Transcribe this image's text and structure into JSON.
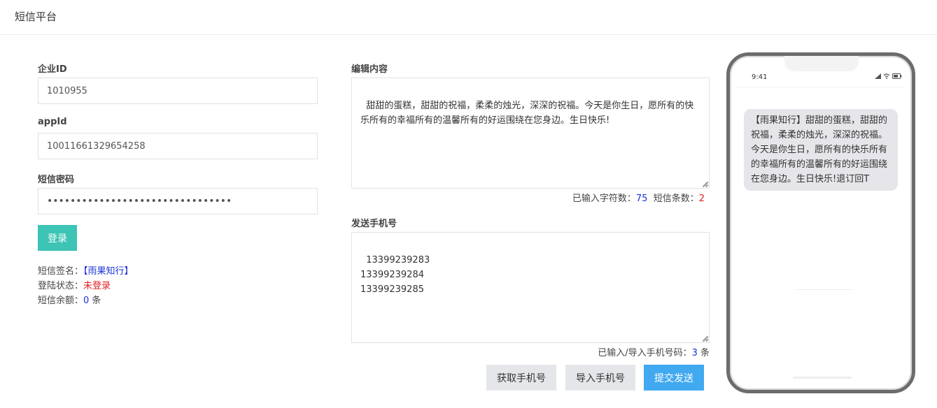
{
  "header": {
    "title": "短信平台"
  },
  "login": {
    "company_id_label": "企业ID",
    "company_id_value": "1010955",
    "app_id_label": "appId",
    "app_id_value": "10011661329654258",
    "sms_key_label": "短信密码",
    "sms_key_value": "••••••••••••••••••••••••••••••••",
    "login_button": "登录"
  },
  "status": {
    "signature_label": "短信签名：",
    "signature_value": "【雨果知行】",
    "login_state_label": "登陆状态：",
    "login_state_value": "未登录",
    "balance_label": "短信余额：",
    "balance_value": "0",
    "balance_unit": " 条"
  },
  "editor": {
    "content_label": "编辑内容",
    "content_value": "甜甜的蛋糕，甜甜的祝福，柔柔的烛光，深深的祝福。今天是你生日，愿所有的快乐所有的幸福所有的温馨所有的好运围绕在您身边。生日快乐!",
    "char_count_label": "已输入字符数：",
    "char_count_value": "75",
    "sms_count_label": "短信条数：",
    "sms_count_value": "2"
  },
  "phones": {
    "label": "发送手机号",
    "value": "13399239283\n13399239284\n13399239285",
    "count_label": "已输入/导入手机号码：",
    "count_value": "3",
    "count_unit": " 条"
  },
  "actions": {
    "get_phones": "获取手机号",
    "import_phones": "导入手机号",
    "submit_send": "提交发送"
  },
  "preview": {
    "time": "9:41",
    "message": "【雨果知行】甜甜的蛋糕，甜甜的祝福，柔柔的烛光，深深的祝福。今天是你生日，愿所有的快乐所有的幸福所有的温馨所有的好运围绕在您身边。生日快乐!退订回T"
  },
  "colors": {
    "primary_green": "#3dc4b5",
    "primary_blue": "#41a9f0",
    "link_blue": "#1a33d6",
    "danger_red": "#e02020"
  }
}
